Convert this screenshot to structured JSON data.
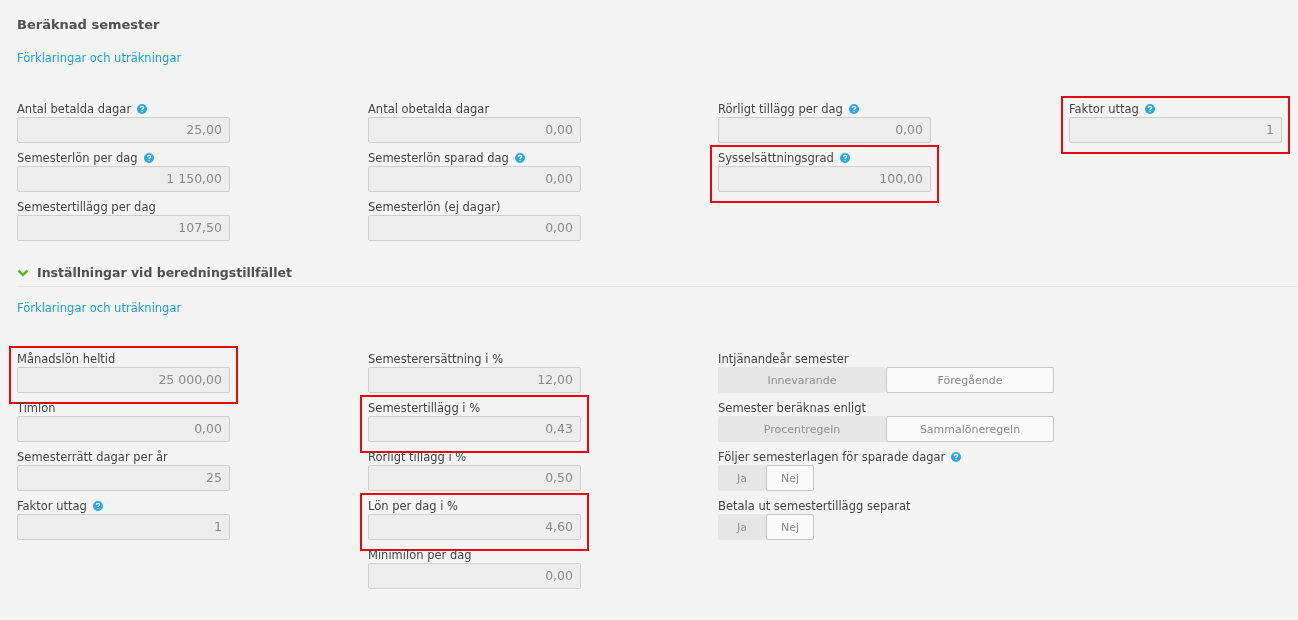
{
  "calculated": {
    "title": "Beräknad semester",
    "link": "Förklaringar och uträkningar",
    "columns": [
      [
        {
          "kind": "field",
          "label": "Antal betalda dagar",
          "help": true,
          "value": "25,00",
          "highlighted": false
        },
        {
          "kind": "field",
          "label": "Semesterlön per dag",
          "help": true,
          "value": "1 150,00",
          "highlighted": false
        },
        {
          "kind": "field",
          "label": "Semestertillägg per dag",
          "help": false,
          "value": "107,50",
          "highlighted": false
        }
      ],
      [
        {
          "kind": "field",
          "label": "Antal obetalda dagar",
          "help": false,
          "value": "0,00",
          "highlighted": false
        },
        {
          "kind": "field",
          "label": "Semesterlön sparad dag",
          "help": true,
          "value": "0,00",
          "highlighted": false
        },
        {
          "kind": "field",
          "label": "Semesterlön (ej dagar)",
          "help": false,
          "value": "0,00",
          "highlighted": false
        }
      ],
      [
        {
          "kind": "field",
          "label": "Rörligt tillägg per dag",
          "help": true,
          "value": "0,00",
          "highlighted": false
        },
        {
          "kind": "field",
          "label": "Sysselsättningsgrad",
          "help": true,
          "value": "100,00",
          "highlighted": true
        }
      ],
      [
        {
          "kind": "field",
          "label": "Faktor uttag",
          "help": true,
          "value": "1",
          "highlighted": true
        }
      ]
    ]
  },
  "settings": {
    "title": "Inställningar vid beredningstillfället",
    "expanded": true,
    "link": "Förklaringar och uträkningar",
    "columns": [
      [
        {
          "kind": "field",
          "label": "Månadslön heltid",
          "help": false,
          "value": "25 000,00",
          "highlighted": true
        },
        {
          "kind": "field",
          "label": "Timlön",
          "help": false,
          "value": "0,00",
          "highlighted": false
        },
        {
          "kind": "field",
          "label": "Semesterrätt dagar per år",
          "help": false,
          "value": "25",
          "highlighted": false
        },
        {
          "kind": "field",
          "label": "Faktor uttag",
          "help": true,
          "value": "1",
          "highlighted": false
        }
      ],
      [
        {
          "kind": "field",
          "label": "Semesterersättning i %",
          "help": false,
          "value": "12,00",
          "highlighted": false
        },
        {
          "kind": "field",
          "label": "Semestertillägg i %",
          "help": false,
          "value": "0,43",
          "highlighted": true
        },
        {
          "kind": "field",
          "label": "Rörligt tillägg i %",
          "help": false,
          "value": "0,50",
          "highlighted": false
        },
        {
          "kind": "field",
          "label": "Lön per dag i %",
          "help": false,
          "value": "4,60",
          "highlighted": true
        },
        {
          "kind": "field",
          "label": "Minimilön per dag",
          "help": false,
          "value": "0,00",
          "highlighted": false
        }
      ],
      [
        {
          "kind": "segmented",
          "label": "Intjänandeår semester",
          "help": false,
          "options": [
            {
              "label": "Innevarande",
              "selected": false
            },
            {
              "label": "Föregående",
              "selected": true
            }
          ]
        },
        {
          "kind": "segmented",
          "label": "Semester beräknas enligt",
          "help": false,
          "options": [
            {
              "label": "Procentregeln",
              "selected": false
            },
            {
              "label": "Sammalöneregeln",
              "selected": true
            }
          ]
        },
        {
          "kind": "yes-no",
          "label": "Följer semesterlagen för sparade dagar",
          "help": true,
          "options": [
            {
              "label": "Ja",
              "selected": false
            },
            {
              "label": "Nej",
              "selected": true
            }
          ]
        },
        {
          "kind": "yes-no",
          "label": "Betala ut semestertillägg separat",
          "help": false,
          "options": [
            {
              "label": "Ja",
              "selected": false
            },
            {
              "label": "Nej",
              "selected": true
            }
          ]
        }
      ]
    ]
  }
}
